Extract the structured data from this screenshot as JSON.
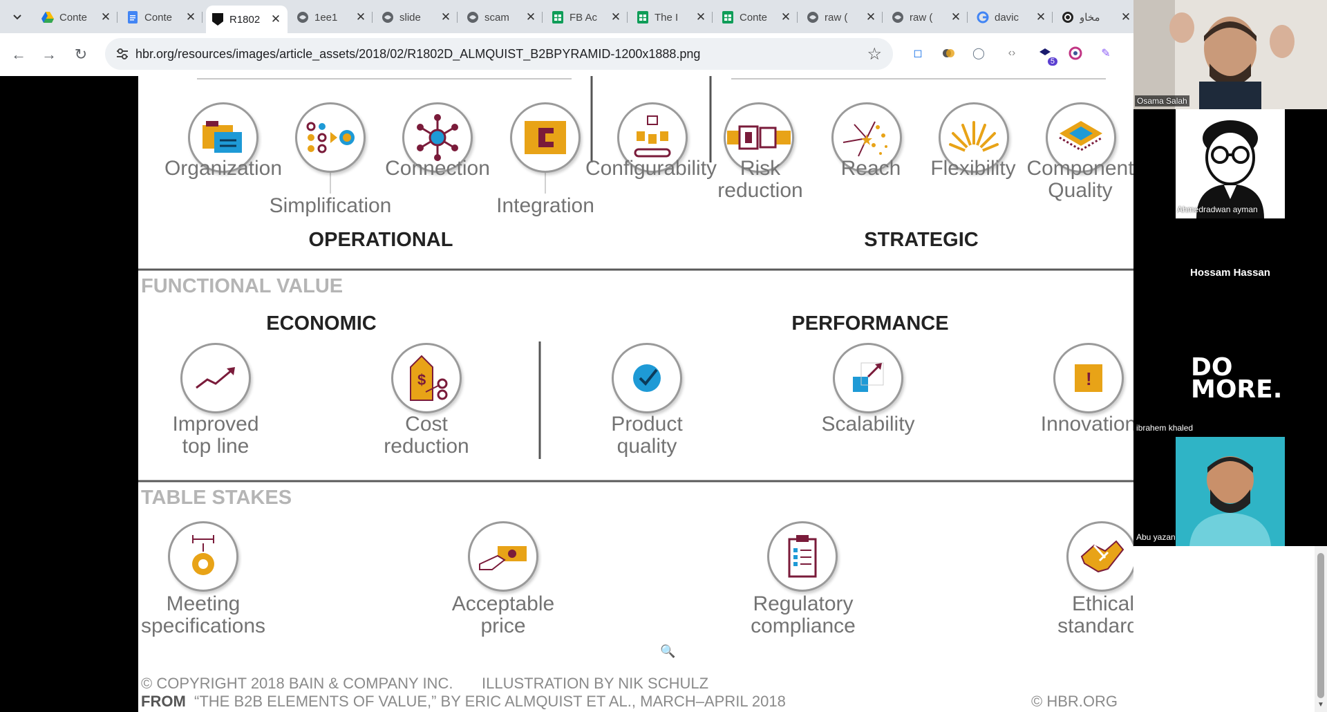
{
  "tabs": [
    {
      "title": "Conte",
      "icon": "google-drive-icon"
    },
    {
      "title": "Conte",
      "icon": "google-docs-icon"
    },
    {
      "title": "R1802",
      "icon": "hbr-icon",
      "active": true
    },
    {
      "title": "1ee1",
      "icon": "globe-icon"
    },
    {
      "title": "slide",
      "icon": "globe-icon"
    },
    {
      "title": "scam",
      "icon": "globe-icon"
    },
    {
      "title": "FB Ac",
      "icon": "google-sheets-icon"
    },
    {
      "title": "The I",
      "icon": "google-sheets-icon"
    },
    {
      "title": "Conte",
      "icon": "google-sheets-icon"
    },
    {
      "title": "raw (",
      "icon": "globe-icon"
    },
    {
      "title": "raw (",
      "icon": "globe-icon"
    },
    {
      "title": "davic",
      "icon": "google-icon"
    },
    {
      "title": "مخاو",
      "icon": "openai-icon"
    }
  ],
  "toolbar": {
    "url": "hbr.org/resources/images/article_assets/2018/02/R1802D_ALMQUIST_B2BPYRAMID-1200x1888.png",
    "extension_badge": "5"
  },
  "infographic": {
    "top_row": [
      {
        "label": "Organization"
      },
      {
        "label": "Simplification"
      },
      {
        "label": "Connection"
      },
      {
        "label": "Integration"
      },
      {
        "label": "Configurability"
      },
      {
        "label": "Risk\nreduction"
      },
      {
        "label": "Reach"
      },
      {
        "label": "Flexibility"
      },
      {
        "label": "Component\nQuality"
      }
    ],
    "group_operational": "OPERATIONAL",
    "group_strategic": "STRATEGIC",
    "section_functional": "FUNCTIONAL VALUE",
    "group_economic": "ECONOMIC",
    "group_performance": "PERFORMANCE",
    "functional": [
      {
        "label": "Improved\ntop line"
      },
      {
        "label": "Cost\nreduction"
      },
      {
        "label": "Product\nquality"
      },
      {
        "label": "Scalability"
      },
      {
        "label": "Innovation"
      }
    ],
    "section_table_stakes": "TABLE STAKES",
    "table_stakes": [
      {
        "label": "Meeting\nspecifications"
      },
      {
        "label": "Acceptable\nprice"
      },
      {
        "label": "Regulatory\ncompliance"
      },
      {
        "label": "Ethical\nstandards"
      }
    ],
    "copyright": "© COPYRIGHT 2018 BAIN & COMPANY INC.",
    "illustration": "ILLUSTRATION BY NIK SCHULZ",
    "from_label": "FROM",
    "from_text": "“THE B2B ELEMENTS OF VALUE,” BY ERIC ALMQUIST ET AL., MARCH–APRIL 2018",
    "hbr": "© HBR.ORG"
  },
  "call": {
    "participants": [
      {
        "name": "Osama Salah"
      },
      {
        "name": "Ahmedradwan ayman"
      },
      {
        "name": "Hossam Hassan"
      },
      {
        "name": "ibrahem khaled",
        "tile_text": "DO\nMORE."
      },
      {
        "name": "Abu yazan"
      }
    ]
  },
  "colors": {
    "accent_orange": "#e8a317",
    "accent_maroon": "#7a1b3a",
    "accent_blue": "#1e9ad6",
    "chrome_bg": "#dfe3e8"
  }
}
